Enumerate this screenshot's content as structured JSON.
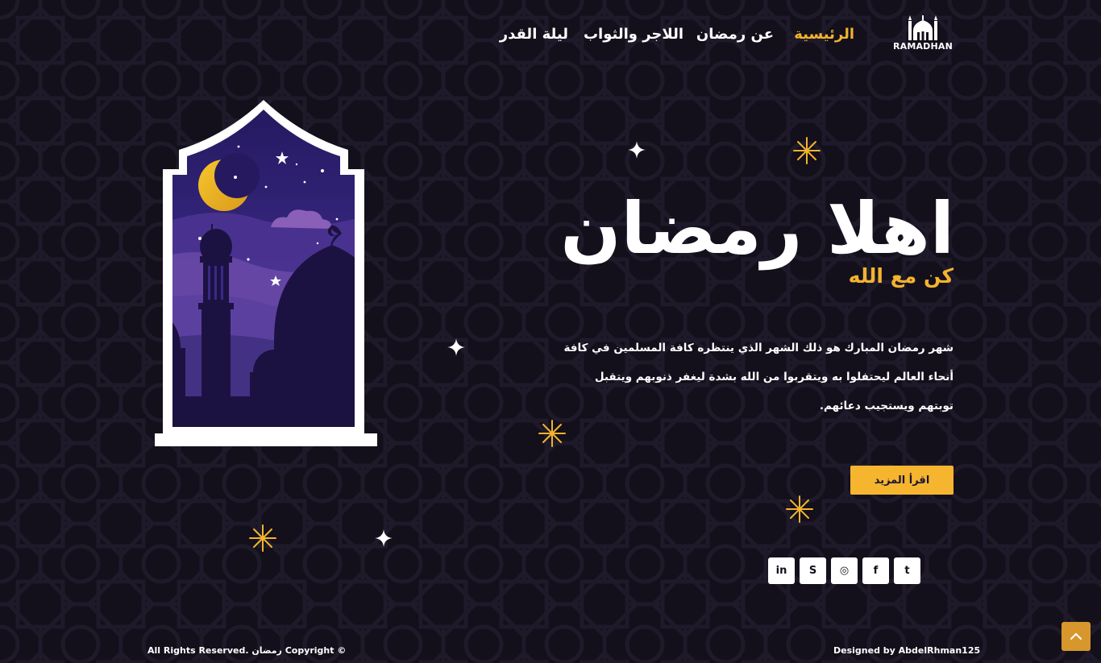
{
  "brand": {
    "logo_text": "RAMADHAN",
    "logo_icon": "mosque-icon"
  },
  "nav": {
    "items": [
      {
        "label": "الرئيسية",
        "active": true
      },
      {
        "label": "عن رمضان",
        "active": false
      },
      {
        "label": "اللاجر والثواب",
        "active": false
      },
      {
        "label": "ليلة القدر",
        "active": false
      }
    ]
  },
  "hero": {
    "title": "اهلا رمضان",
    "subtitle": "كن مع الله",
    "description": "شهر رمضان المبارك هو ذلك الشهر الذي ينتظره كافة المسلمين في كافة أنحاء العالم ليحتفلوا به ويتقربوا من الله بشدة ليغفر ذنوبهم ويتقبل توبتهم ويستجيب دعائهم.",
    "button_label": "اقرأ المزيد"
  },
  "social": [
    {
      "label": "in",
      "icon": "linkedin-icon"
    },
    {
      "label": "S",
      "icon": "skype-icon"
    },
    {
      "label": "◎",
      "icon": "instagram-icon"
    },
    {
      "label": "f",
      "icon": "facebook-icon"
    },
    {
      "label": "t",
      "icon": "twitter-icon"
    }
  ],
  "footer": {
    "copyright": "All Rights Reserved. رمضان Copyright ©",
    "designed_by": "Designed by AbdelRhman125"
  },
  "colors": {
    "background": "#130f1b",
    "accent": "#f2b32e",
    "button": "#f5b52e",
    "scroll_top": "#d8972c",
    "night_sky": "#2e2170"
  },
  "icons": {
    "scroll_top": "chevron-up-icon",
    "sparkle": "sparkle-icon",
    "star": "star-icon"
  }
}
